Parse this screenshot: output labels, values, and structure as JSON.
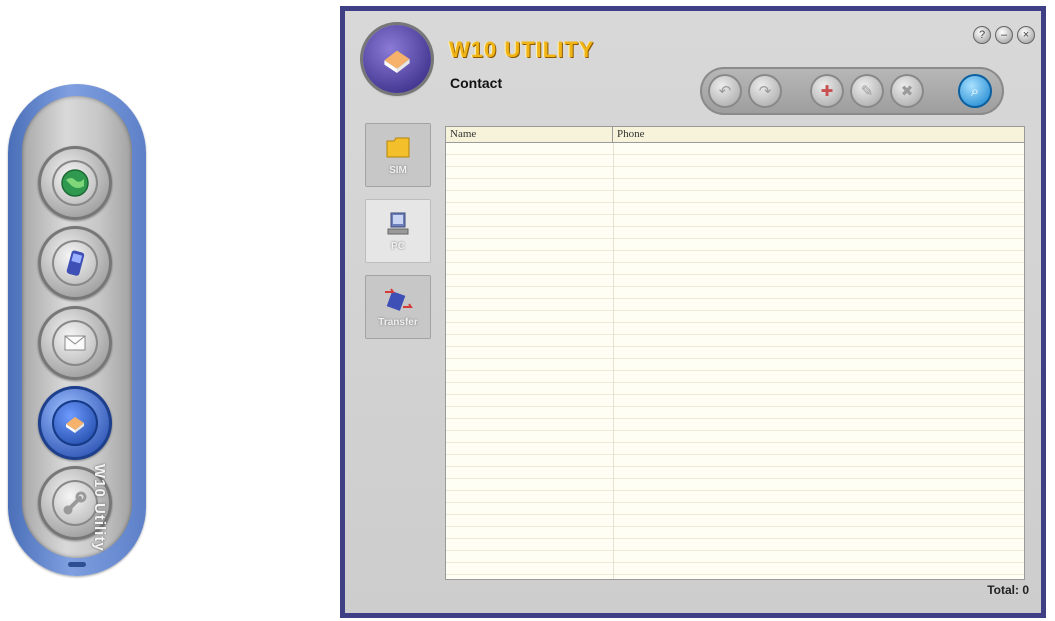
{
  "launcher": {
    "vertical_label": "W10 Utility",
    "buttons": [
      {
        "icon": "globe-icon"
      },
      {
        "icon": "phone-icon"
      },
      {
        "icon": "envelope-icon"
      },
      {
        "icon": "contact-book-icon",
        "active": true
      },
      {
        "icon": "wrench-icon"
      }
    ]
  },
  "window": {
    "app_title": "W10 UTILITY",
    "page_title": "Contact",
    "controls": [
      "?",
      "–",
      "×"
    ],
    "toolbar": [
      {
        "icon": "back-icon",
        "glyph": "↶"
      },
      {
        "icon": "forward-icon",
        "glyph": "↷"
      },
      {
        "icon": "new-contact-icon",
        "glyph": "✚"
      },
      {
        "icon": "edit-icon",
        "glyph": "✎"
      },
      {
        "icon": "delete-icon",
        "glyph": "✖"
      },
      {
        "icon": "search-icon",
        "glyph": "⌕",
        "on": true
      }
    ],
    "side_tabs": [
      {
        "label": "SIM",
        "icon": "sim-card-icon"
      },
      {
        "label": "PC",
        "icon": "computer-icon",
        "selected": true
      },
      {
        "label": "Transfer",
        "icon": "transfer-icon"
      }
    ],
    "table": {
      "columns": [
        "Name",
        "Phone"
      ],
      "rows": []
    },
    "total_label": "Total: 0"
  }
}
